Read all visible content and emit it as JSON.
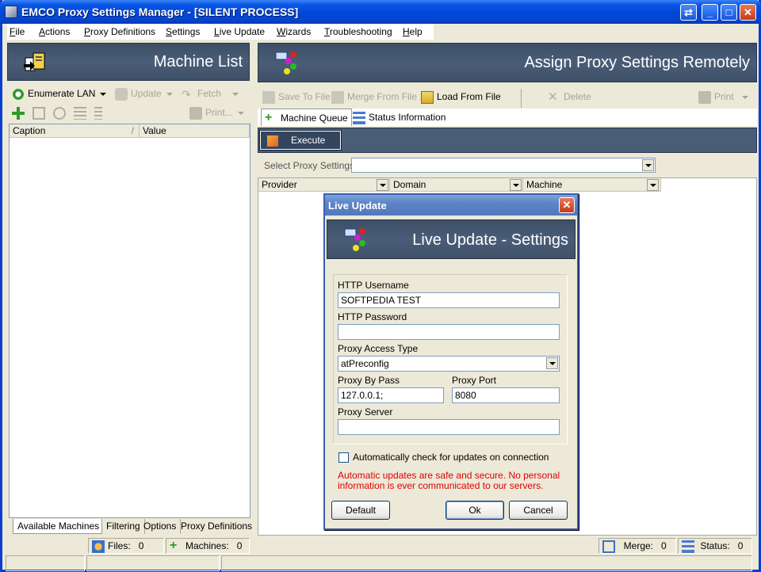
{
  "window": {
    "title": "EMCO Proxy Settings Manager - [SILENT PROCESS]",
    "buttons": [
      "restore-swap",
      "minimize",
      "maximize",
      "close"
    ]
  },
  "menu": [
    "File",
    "Actions",
    "Proxy Definitions",
    "Settings",
    "Live Update",
    "Wizards",
    "Troubleshooting",
    "Help"
  ],
  "left": {
    "header_title": "Machine List",
    "toolbar1": {
      "enumerate": "Enumerate LAN",
      "update": "Update",
      "fetch": "Fetch"
    },
    "toolbar2": {
      "print": "Print..."
    },
    "columns": [
      "Caption",
      "Value"
    ],
    "tabs": [
      "Available Machines",
      "Filtering",
      "Options",
      "Proxy Definitions"
    ],
    "status": {
      "files_label": "Files:",
      "files_value": "0",
      "machines_label": "Machines:",
      "machines_value": "0"
    }
  },
  "right": {
    "header_title": "Assign Proxy Settings Remotely",
    "toolbar": {
      "save": "Save To File",
      "merge": "Merge From File",
      "load": "Load From File",
      "delete": "Delete",
      "print": "Print"
    },
    "tabs": [
      "Machine Queue",
      "Status Information"
    ],
    "execute": "Execute",
    "select_label": "Select Proxy Settings :",
    "select_value": "",
    "columns": [
      "Provider",
      "Domain",
      "Machine"
    ],
    "status": {
      "merge_label": "Merge:",
      "merge_value": "0",
      "status_label": "Status:",
      "status_value": "0"
    }
  },
  "dialog": {
    "title": "Live Update",
    "header_title": "Live Update - Settings",
    "http_username_label": "HTTP Username",
    "http_username_value": "SOFTPEDIA TEST",
    "http_password_label": "HTTP Password",
    "http_password_value": "",
    "proxy_access_type_label": "Proxy Access Type",
    "proxy_access_type_value": "atPreconfig",
    "proxy_bypass_label": "Proxy By Pass",
    "proxy_bypass_value": "127.0.0.1;",
    "proxy_port_label": "Proxy Port",
    "proxy_port_value": "8080",
    "proxy_server_label": "Proxy Server",
    "proxy_server_value": "",
    "auto_check_label": "Automatically check for updates on connection",
    "auto_check_checked": false,
    "note_line1": "Automatic updates are safe and secure. No personal",
    "note_line2": "information is ever communicated to our servers.",
    "default_button": "Default",
    "ok_button": "Ok",
    "cancel_button": "Cancel"
  },
  "colors": {
    "titlebar": "#0a56e6",
    "panel_header": "#4a5d77",
    "dialog_title": "#5c84c6",
    "note_text": "#e00000"
  }
}
